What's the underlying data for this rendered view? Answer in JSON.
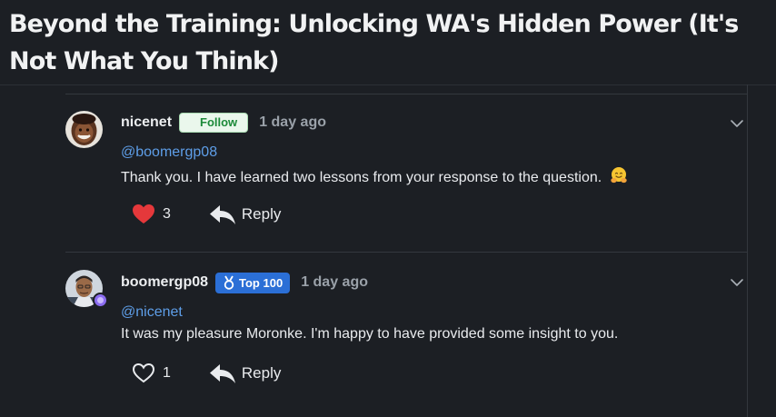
{
  "topic": {
    "title": "Beyond the Training: Unlocking WA's Hidden Power (It's Not What You Think)"
  },
  "comments": [
    {
      "username": "nicenet",
      "follow_label": "Follow",
      "time": "1 day ago",
      "mention": "@boomergp08",
      "text": "Thank you. I have learned two lessons from your response to the question.",
      "emoji": "hugging-face",
      "likes": "3",
      "liked": true,
      "reply_label": "Reply"
    },
    {
      "username": "boomergp08",
      "badge_label": "Top 100",
      "time": "1 day ago",
      "mention": "@nicenet",
      "text": "It was my pleasure Moronke. I'm happy to have provided some insight to you.",
      "likes": "1",
      "liked": false,
      "reply_label": "Reply"
    }
  ],
  "colors": {
    "background": "#1c1f24",
    "like_active": "#e5383b",
    "mention": "#5e9ee8",
    "follow_text": "#1d8a3a",
    "badge": "#2b6fd6"
  },
  "icons": {
    "like_active": "heart-filled-icon",
    "like_inactive": "heart-outline-icon",
    "reply": "reply-arrow-icon",
    "menu": "chevron-down-icon",
    "badge": "medal-icon"
  }
}
